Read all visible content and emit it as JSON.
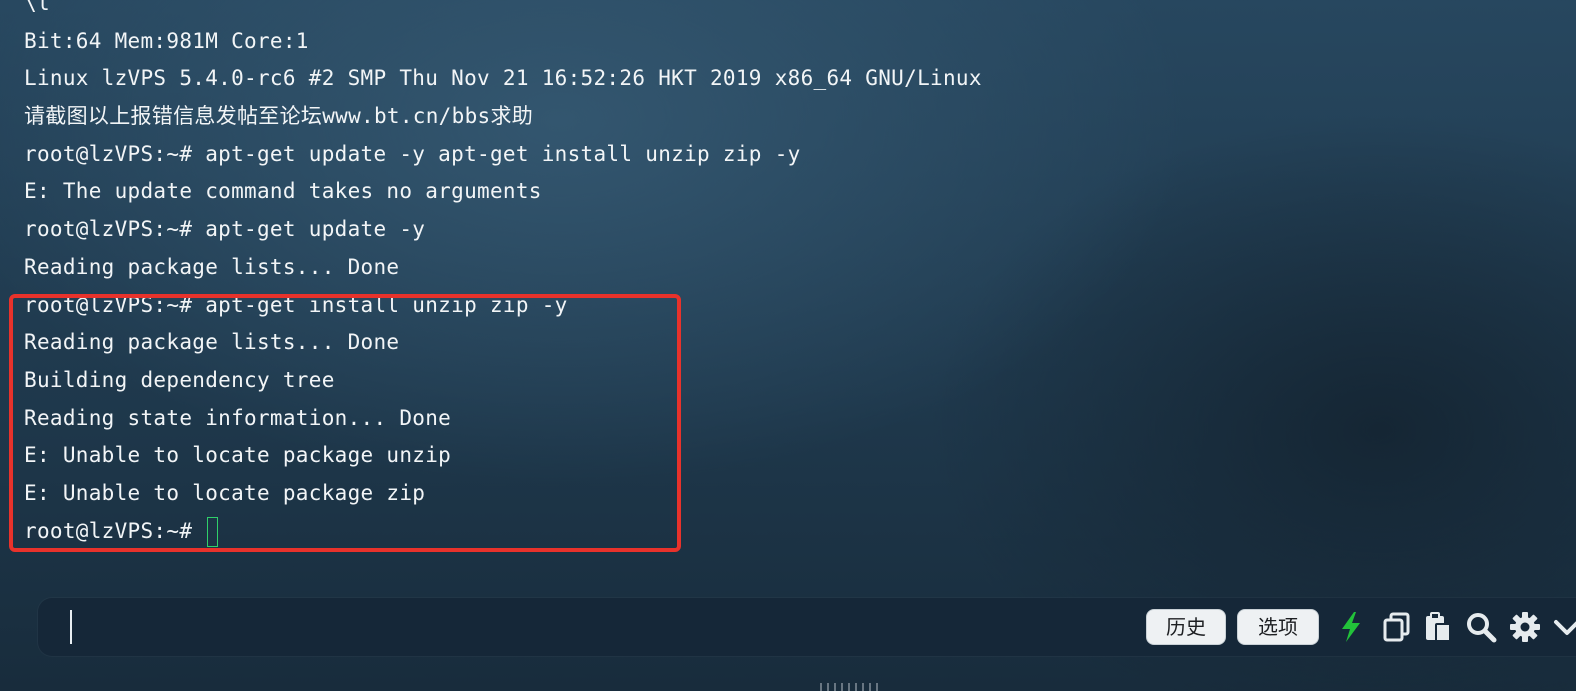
{
  "terminal": {
    "lines": [
      "\\l",
      "Bit:64 Mem:981M Core:1",
      "Linux lzVPS 5.4.0-rc6 #2 SMP Thu Nov 21 16:52:26 HKT 2019 x86_64 GNU/Linux",
      "请截图以上报错信息发帖至论坛www.bt.cn/bbs求助",
      "root@lzVPS:~# apt-get update -y apt-get install unzip zip -y",
      "E: The update command takes no arguments",
      "root@lzVPS:~# apt-get update -y",
      "Reading package lists... Done",
      "root@lzVPS:~# apt-get install unzip zip -y",
      "Reading package lists... Done",
      "Building dependency tree",
      "Reading state information... Done",
      "E: Unable to locate package unzip",
      "E: Unable to locate package zip",
      "root@lzVPS:~# "
    ],
    "cursor_color": "#2fd06a",
    "highlight_color": "#e8322b"
  },
  "toolbar": {
    "history_label": "历史",
    "options_label": "选项",
    "icons": [
      "bolt-icon",
      "copy-icon",
      "paste-icon",
      "search-icon",
      "gear-icon",
      "chevron-down-icon"
    ],
    "bolt_color": "#22c23a"
  }
}
